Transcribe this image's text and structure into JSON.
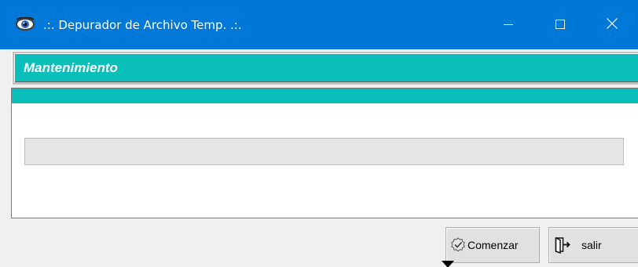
{
  "window": {
    "title": ".:. Depurador de Archivo Temp. .:.",
    "app_icon": "eye-icon",
    "controls": {
      "minimize_icon": "minimize-icon",
      "maximize_icon": "maximize-icon",
      "close_icon": "close-icon"
    },
    "title_bar_color": "#0078d7"
  },
  "header": {
    "title": "Mantenimiento",
    "accent_color": "#0abfb9"
  },
  "main": {
    "progress": {
      "value_percent": 0
    }
  },
  "buttons": {
    "start": {
      "label": "Comenzar",
      "icon": "check-badge-icon"
    },
    "exit": {
      "label": "salir",
      "icon": "exit-door-icon"
    }
  }
}
